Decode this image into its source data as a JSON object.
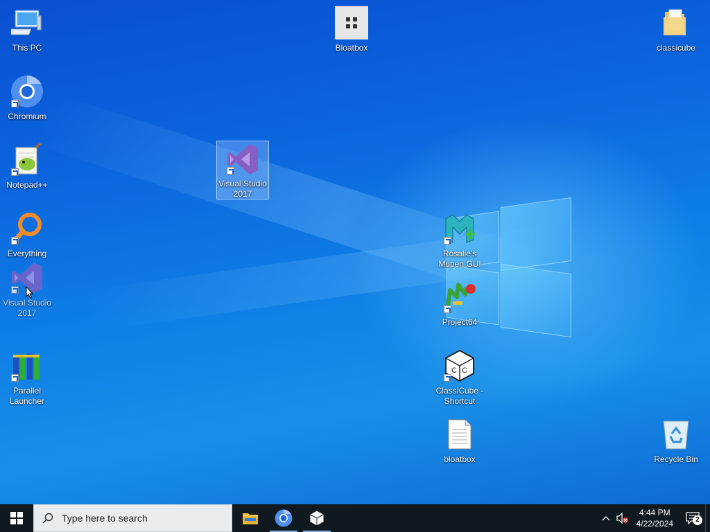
{
  "desktop": {
    "icons": {
      "this_pc": "This PC",
      "bloatbox": "Bloatbox",
      "classicube": "classicube",
      "chromium": "Chromium",
      "notepadpp": "Notepad++",
      "visual_studio_selected": "Visual Studio 2017",
      "everything": "Everything",
      "visual_studio": "Visual Studio 2017",
      "rosalies_mupen": "Rosalie's Mupen GUI",
      "project64": "Project64",
      "parallel_launcher": "Parallel Launcher",
      "classicube_shortcut": "ClassiCube - Shortcut",
      "bloatbox_file": "bloatbox",
      "recycle_bin": "Recycle Bin"
    }
  },
  "taskbar": {
    "search_placeholder": "Type here to search",
    "pinned": [
      "file-explorer-icon",
      "chromium-icon",
      "classicube-icon"
    ],
    "clock": {
      "time": "4:44 PM",
      "date": "4/22/2024"
    },
    "notification_count": "2"
  },
  "colors": {
    "taskbar": "#101820",
    "desktop_accent": "#0b66de",
    "search_box": "#e9ecef"
  }
}
